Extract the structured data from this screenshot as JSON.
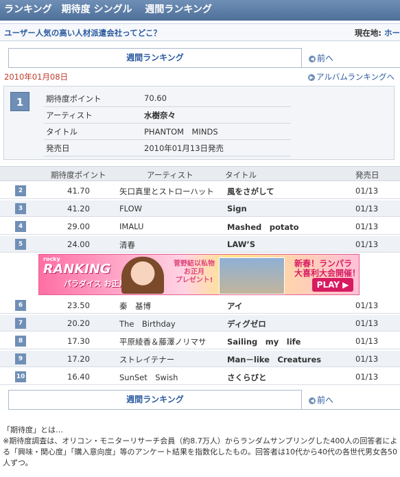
{
  "header": {
    "title": "ランキング　期待度 シングル　 週間ランキング",
    "question_link": "ユーザー人気の高い人材派遣会社ってどこ？",
    "location_prefix": "現在地:",
    "location_link": "ホー"
  },
  "tabs": {
    "label": "週間ランキング",
    "prev_label": "前へ"
  },
  "date": "2010年01月08日",
  "album_link": "アルバムランキングへ",
  "top": {
    "rank": "1",
    "rows": [
      {
        "key": "期待度ポイント",
        "value": "70.60"
      },
      {
        "key": "アーティスト",
        "value": "水樹奈々"
      },
      {
        "key": "タイトル",
        "value": "PHANTOM　MINDS"
      },
      {
        "key": "発売日",
        "value": "2010年01月13日発売"
      }
    ]
  },
  "table_header": {
    "points": "期待度ポイント",
    "artist": "アーティスト",
    "title": "タイトル",
    "date": "発売日"
  },
  "rows": [
    {
      "rank": "2",
      "points": "41.70",
      "artist": "矢口真里とストローハット",
      "title": "風をさがして",
      "date": "01/13"
    },
    {
      "rank": "3",
      "points": "41.20",
      "artist": "FLOW",
      "title": "Sign",
      "date": "01/13"
    },
    {
      "rank": "4",
      "points": "29.00",
      "artist": "IMALU",
      "title": "Mashed　potato",
      "date": "01/13"
    },
    {
      "rank": "5",
      "points": "24.00",
      "artist": "清春",
      "title": "LAW’S",
      "date": "01/13"
    },
    {
      "rank": "6",
      "points": "23.50",
      "artist": "秦　基博",
      "title": "アイ",
      "date": "01/13"
    },
    {
      "rank": "7",
      "points": "20.20",
      "artist": "The　Birthday",
      "title": "ディグゼロ",
      "date": "01/13"
    },
    {
      "rank": "8",
      "points": "17.30",
      "artist": "平原綾香＆藤澤ノリマサ",
      "title": "Sailing　my　life",
      "date": "01/13"
    },
    {
      "rank": "9",
      "points": "17.20",
      "artist": "ストレイテナー",
      "title": "Man－like　Creatures",
      "date": "01/13"
    },
    {
      "rank": "10",
      "points": "16.40",
      "artist": "SunSet　Swish",
      "title": "さくらびと",
      "date": "01/13"
    }
  ],
  "banner": {
    "tag": "rocky",
    "brand": "RANKING",
    "sub": "パラダイス",
    "sub2": "お正月SP!",
    "gift_line1": "菅野結以私物",
    "gift_line2": "お正月",
    "gift_line3": "プレゼント!",
    "right_line1": "新春！ランパラ",
    "right_line2": "大喜利大会開催！",
    "play": "PLAY ▶"
  },
  "note": {
    "line1": "「期待度」とは…",
    "line2": "※期待度調査は、オリコン・モニターリサーチ会員（約8.7万人）からランダムサンプリングした400人の回答者による「興味・関心度」「購入意向度」等のアンケート結果を指数化したもの。回答者は10代から40代の各世代男女各50人ずつ。"
  }
}
